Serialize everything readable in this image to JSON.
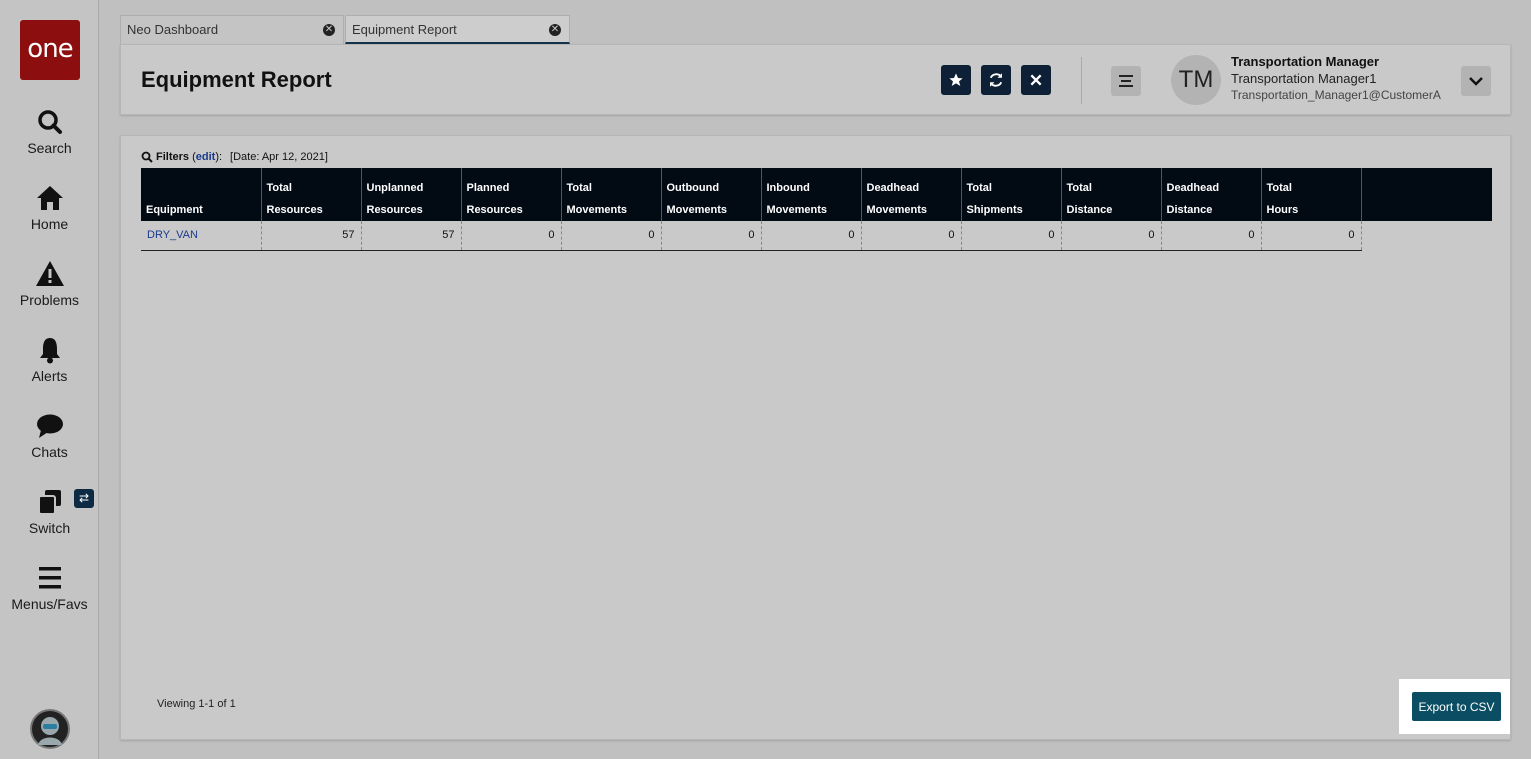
{
  "app": {
    "logo_text": "one",
    "brand_color": "#8d0e0e"
  },
  "sidebar": {
    "items": [
      {
        "label": "Search",
        "icon": "search-icon"
      },
      {
        "label": "Home",
        "icon": "home-icon"
      },
      {
        "label": "Problems",
        "icon": "warning-icon"
      },
      {
        "label": "Alerts",
        "icon": "bell-icon"
      },
      {
        "label": "Chats",
        "icon": "chat-icon"
      },
      {
        "label": "Switch",
        "icon": "switch-icon"
      },
      {
        "label": "Menus/Favs",
        "icon": "menu-icon"
      }
    ],
    "switch_badge": "⇄"
  },
  "tabs": [
    {
      "label": "Neo Dashboard",
      "active": false
    },
    {
      "label": "Equipment Report",
      "active": true
    }
  ],
  "header": {
    "title": "Equipment Report",
    "user": {
      "initials": "TM",
      "name": "Transportation Manager",
      "role": "Transportation Manager1",
      "email": "Transportation_Manager1@CustomerA"
    }
  },
  "filters": {
    "label": "Filters",
    "edit": "edit",
    "value": "[Date: Apr 12, 2021]"
  },
  "table": {
    "columns": [
      [
        "",
        "Equipment"
      ],
      [
        "Total",
        "Resources"
      ],
      [
        "Unplanned",
        "Resources"
      ],
      [
        "Planned",
        "Resources"
      ],
      [
        "Total",
        "Movements"
      ],
      [
        "Outbound",
        "Movements"
      ],
      [
        "Inbound",
        "Movements"
      ],
      [
        "Deadhead",
        "Movements"
      ],
      [
        "Total",
        "Shipments"
      ],
      [
        "Total",
        "Distance"
      ],
      [
        "Deadhead",
        "Distance"
      ],
      [
        "Total",
        "Hours"
      ]
    ],
    "rows": [
      [
        "DRY_VAN",
        "57",
        "57",
        "0",
        "0",
        "0",
        "0",
        "0",
        "0",
        "0",
        "0",
        "0"
      ]
    ]
  },
  "footer": {
    "viewing": "Viewing 1-1 of 1",
    "export_label": "Export to CSV"
  }
}
